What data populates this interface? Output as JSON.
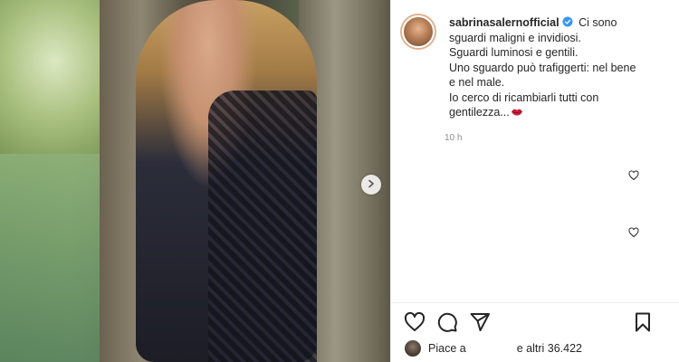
{
  "post": {
    "username": "sabrinasalernofficial",
    "verified": true,
    "caption_lines": [
      "Ci sono",
      "sguardi maligni e invidiosi.",
      "Sguardi luminosi e gentili.",
      "Uno sguardo può trafiggerti: nel bene",
      "e nel male.",
      "Io cerco di ricambiarli tutti con",
      "gentilezza..."
    ],
    "timestamp": "10 h",
    "likes_prefix": "Piace a",
    "likes_suffix": "e altri 36.422"
  },
  "icons": {
    "verified": "verified-badge-icon",
    "emoji": "lips-emoji-icon",
    "next": "chevron-right-icon",
    "like": "heart-icon",
    "comment": "comment-bubble-icon",
    "share": "paper-plane-icon",
    "save": "bookmark-icon"
  },
  "colors": {
    "verified_blue": "#3897f0",
    "text": "#262626",
    "muted": "#8e8e8e",
    "divider": "#efefef"
  }
}
